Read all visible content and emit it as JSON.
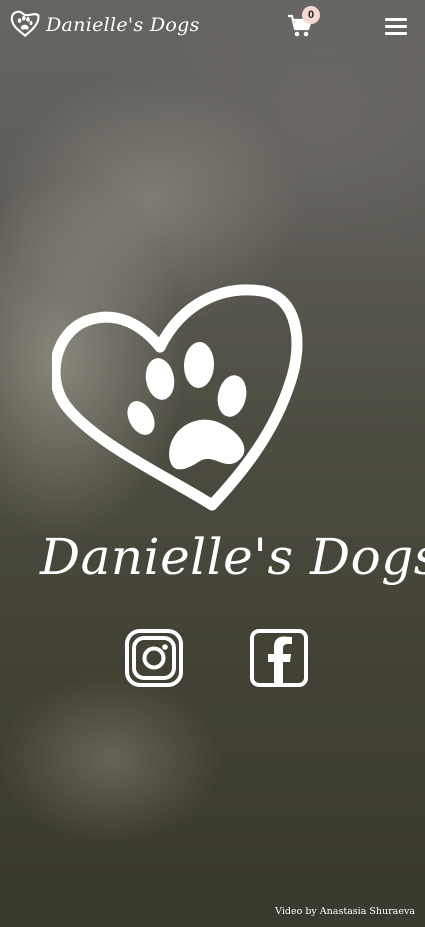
{
  "header": {
    "brand_name": "Danielle's Dogs",
    "cart_count": "0"
  },
  "hero": {
    "brand_name": "Danielle's Dogs"
  },
  "social": {
    "links": [
      {
        "name": "instagram-icon"
      },
      {
        "name": "facebook-icon"
      }
    ]
  },
  "footer": {
    "video_credit": "Video by Anastasia Shuraeva"
  },
  "colors": {
    "text": "#ffffff",
    "cart_badge": "#f3d9d2"
  }
}
